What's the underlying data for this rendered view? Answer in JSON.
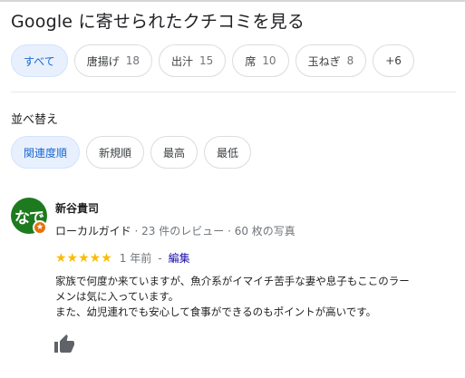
{
  "header": {
    "title": "Google に寄せられたクチコミを見る"
  },
  "filters": [
    {
      "label": "すべて",
      "count": "",
      "selected": true
    },
    {
      "label": "唐揚げ",
      "count": "18",
      "selected": false
    },
    {
      "label": "出汁",
      "count": "15",
      "selected": false
    },
    {
      "label": "席",
      "count": "10",
      "selected": false
    },
    {
      "label": "玉ねぎ",
      "count": "8",
      "selected": false
    },
    {
      "label": "+6",
      "count": "",
      "selected": false
    }
  ],
  "sort": {
    "label": "並べ替え",
    "options": [
      {
        "label": "関連度順",
        "selected": true
      },
      {
        "label": "新規順",
        "selected": false
      },
      {
        "label": "最高",
        "selected": false
      },
      {
        "label": "最低",
        "selected": false
      }
    ]
  },
  "review": {
    "avatar_text": "なで",
    "reviewer_name": "新谷貴司",
    "local_guide": "ローカルガイド",
    "meta_separator": "·",
    "review_count": "23 件のレビュー",
    "photo_count": "60 枚の写真",
    "stars": "★★★★★",
    "rating": 5,
    "date": "1 年前",
    "separator": "-",
    "tag": "編集",
    "body_lines": [
      "家族で何度か来ていますが、魚介系がイマイチ苦手な妻や息子もここのラー",
      "メンは気に入っています。",
      "また、幼児連れでも安心して食事ができるのもポイントが高いです。"
    ]
  },
  "icons": {
    "guide_badge": "star-icon",
    "like": "thumbs-up-icon"
  },
  "colors": {
    "selected_chip_bg": "#e8f0fe",
    "selected_chip_text": "#1967d2",
    "star": "#fbbc04",
    "avatar_bg": "#1e7a1e",
    "badge": "#e8710a",
    "link": "#1a0dab"
  }
}
